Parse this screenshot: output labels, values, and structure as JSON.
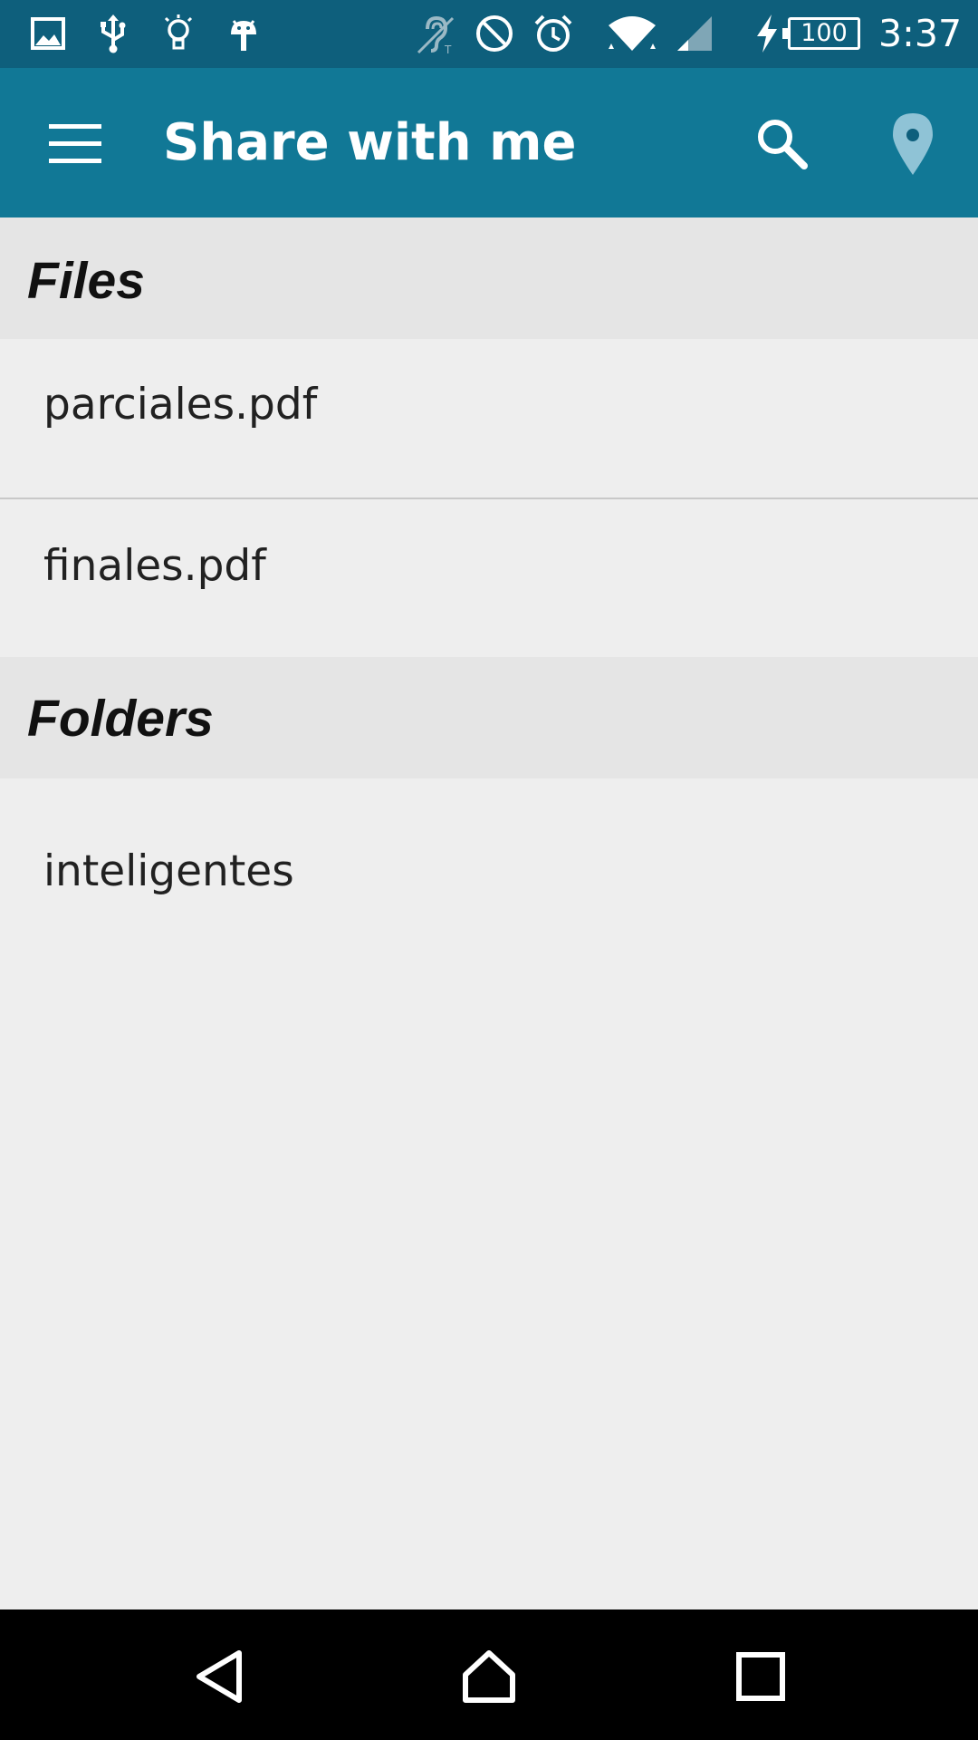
{
  "status_bar": {
    "icons": [
      "image-icon",
      "usb-icon",
      "lightbulb-icon",
      "android-icon",
      "hearing-aid-icon",
      "do-not-disturb-icon",
      "alarm-icon",
      "wifi-icon",
      "signal-icon",
      "charging-icon"
    ],
    "battery_level": "100",
    "time": "3:37"
  },
  "app_bar": {
    "title": "Share with me",
    "icons": [
      "menu-icon",
      "search-icon",
      "location-pin-icon"
    ]
  },
  "sections": {
    "files": {
      "header": "Files",
      "items": [
        "parciales.pdf",
        "finales.pdf"
      ]
    },
    "folders": {
      "header": "Folders",
      "items": [
        "inteligentes"
      ]
    }
  },
  "nav_bar": {
    "icons": [
      "back-icon",
      "home-icon",
      "recents-icon"
    ]
  },
  "colors": {
    "status_bar": "#0e5f7c",
    "app_bar": "#117896",
    "section_header_bg": "#e5e5e5",
    "content_bg": "#eeeeee",
    "location_pin": "#8fc3d6"
  }
}
